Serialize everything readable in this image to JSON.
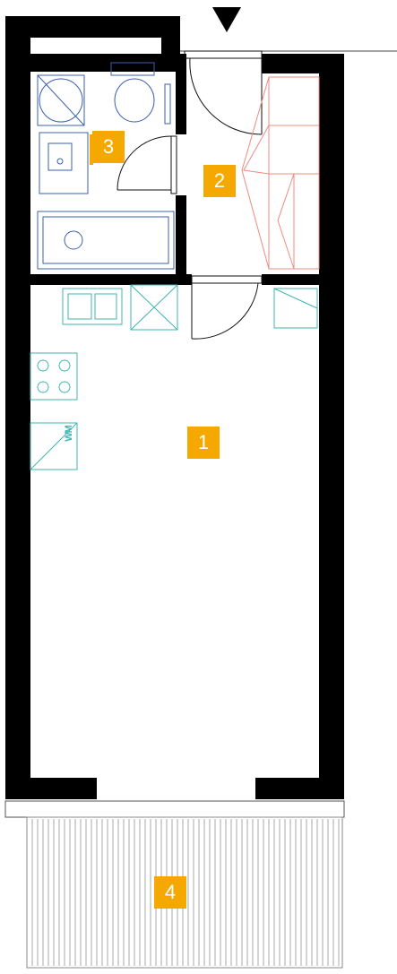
{
  "rooms": {
    "room1": {
      "label": "1"
    },
    "room2": {
      "label": "2"
    },
    "room3": {
      "label": "3"
    },
    "room4": {
      "label": "4"
    }
  },
  "appliances": {
    "washing_machine": {
      "label": "WM"
    }
  },
  "colors": {
    "wall": "#000000",
    "badge": "#f5a800",
    "furniture": "#f08a80",
    "fixtures": "#3fb6b0",
    "bathroom": "#3a5fb0",
    "door": "#111111"
  },
  "icons": {
    "entrance": "entrance-arrow-icon"
  }
}
